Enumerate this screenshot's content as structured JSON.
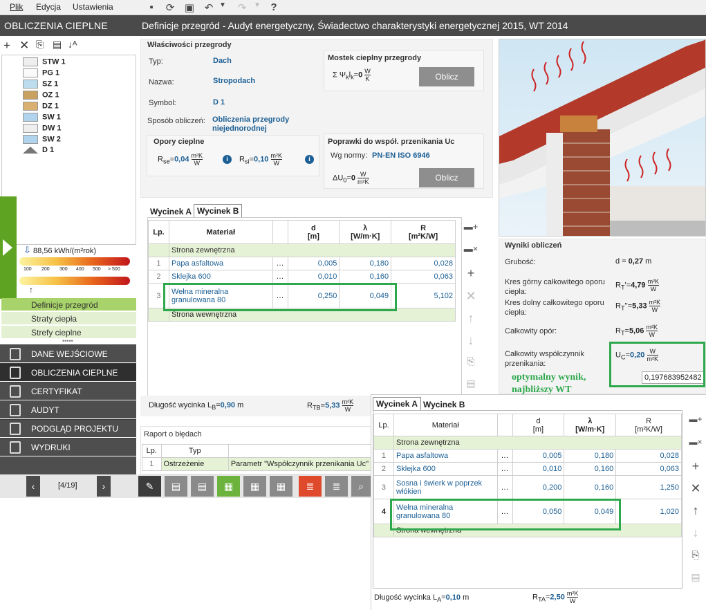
{
  "menu": {
    "file": "Plik",
    "edit": "Edycja",
    "settings": "Ustawienia"
  },
  "left": {
    "title": "OBLICZENIA CIEPLNE",
    "tree": [
      "STW 1",
      "PG 1",
      "SZ 1",
      "OZ 1",
      "DZ 1",
      "SW 1",
      "DW 1",
      "SW 2",
      "D 1"
    ],
    "energy_value": "88,56 kWh/(m²rok)",
    "scale": [
      "100",
      "200",
      "300",
      "400",
      "500",
      "> 500"
    ],
    "subitems": [
      "Definicje przegród",
      "Straty ciepła",
      "Strefy cieplne"
    ],
    "nav": [
      "DANE WEJŚCIOWE",
      "OBLICZENIA CIEPLNE",
      "CERTYFIKAT",
      "AUDYT",
      "PODGLĄD PROJEKTU",
      "WYDRUKI"
    ],
    "pager": "[4/19]"
  },
  "header": {
    "title": "Definicje przegród - Audyt energetyczny, Świadectwo charakterystyki energetycznej 2015, WT 2014"
  },
  "props": {
    "section": "Właściwości przegrody",
    "typ_label": "Typ:",
    "typ": "Dach",
    "nazwa_label": "Nazwa:",
    "nazwa": "Stropodach",
    "symbol_label": "Symbol:",
    "symbol": "D 1",
    "sposob_label": "Sposób obliczeń:",
    "sposob": "Obliczenia przegrody niejednorodnej",
    "opory_title": "Opory cieplne",
    "rse": "0,04",
    "rsi": "0,10",
    "mostek_title": "Mostek cieplny przegrody",
    "psi": "0",
    "oblicz": "Oblicz",
    "poprawki_title": "Poprawki do współ. przenikania Uc",
    "wg_normy_label": "Wg normy:",
    "norma": "PN-EN ISO 6946",
    "du": "0"
  },
  "tabB": {
    "tabA": "Wycinek A",
    "tabB": "Wycinek B",
    "headers": [
      "Lp.",
      "Materiał",
      "d",
      "λ",
      "R"
    ],
    "units": [
      "[m]",
      "[W/m·K]",
      "[m²K/W]"
    ],
    "outer": "Strona zewnętrzna",
    "inner": "Strona wewnętrzna",
    "rows": [
      {
        "lp": "1",
        "mat": "Papa asfaltowa",
        "d": "0,005",
        "l": "0,180",
        "r": "0,028"
      },
      {
        "lp": "2",
        "mat": "Sklejka 600",
        "d": "0,010",
        "l": "0,160",
        "r": "0,063"
      },
      {
        "lp": "3",
        "mat": "Wełna mineralna granulowana 80",
        "d": "0,250",
        "l": "0,049",
        "r": "5,102"
      }
    ],
    "length_label": "Długość wycinka L",
    "length_sub": "B",
    "length_val": "0,90",
    "length_unit": "m",
    "rtb_label": "R",
    "rtb_sub": "TB",
    "rtb_val": "5,33"
  },
  "errors": {
    "title": "Raport o błędach",
    "h_lp": "Lp.",
    "h_typ": "Typ",
    "lp": "1",
    "typ": "Ostrzeżenie",
    "msg": "Parametr \"Współczynnik przenikania Uc\""
  },
  "results": {
    "title": "Wyniki obliczeń",
    "grubosc_label": "Grubość:",
    "grubosc": "0,27",
    "grubosc_unit": "m",
    "gorny_label": "Kres górny całkowitego oporu ciepła:",
    "gorny": "4,79",
    "dolny_label": "Kres dolny całkowitego oporu ciepła:",
    "dolny": "5,33",
    "opor_label": "Całkowity opór:",
    "opor": "5,06",
    "uc_label": "Całkowity współczynnik przenikania:",
    "uc": "0,20",
    "tooltip": "0,197683952482",
    "note1": "optymalny wynik,",
    "note2": "najbliższy WT"
  },
  "tabA": {
    "tabA": "Wycinek A",
    "tabB": "Wycinek B",
    "headers": [
      "Lp.",
      "Materiał",
      "d",
      "λ",
      "R"
    ],
    "units": [
      "[m]",
      "[W/m·K]",
      "[m²K/W]"
    ],
    "outer": "Strona zewnętrzna",
    "inner": "Strona wewnętrzna",
    "rows": [
      {
        "lp": "1",
        "mat": "Papa asfaltowa",
        "d": "0,005",
        "l": "0,180",
        "r": "0,028"
      },
      {
        "lp": "2",
        "mat": "Sklejka 600",
        "d": "0,010",
        "l": "0,160",
        "r": "0,063"
      },
      {
        "lp": "3",
        "mat": "Sosna i świerk w poprzek włókien",
        "d": "0,200",
        "l": "0,160",
        "r": "1,250"
      },
      {
        "lp": "4",
        "mat": "Wełna mineralna granulowana 80",
        "d": "0,050",
        "l": "0,049",
        "r": "1,020"
      }
    ],
    "length_label": "Długość wycinka L",
    "length_sub": "A",
    "length_val": "0,10",
    "length_unit": "m",
    "rta_label": "R",
    "rta_sub": "TA",
    "rta_val": "2,50"
  },
  "colors": {
    "accent_green": "#2ea84c",
    "header": "#4a4a4a",
    "blue_text": "#1b5f95",
    "orange": "#e04a2c"
  }
}
